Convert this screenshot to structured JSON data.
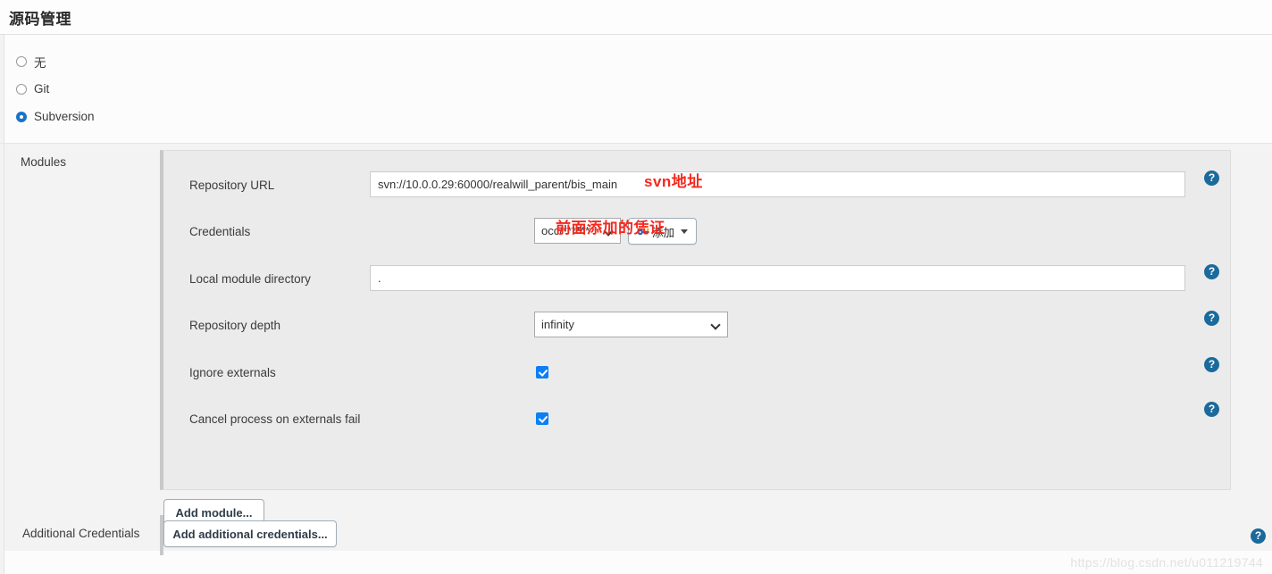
{
  "header": {
    "title": "源码管理"
  },
  "scm_options": [
    {
      "label": "无",
      "checked": false,
      "name": "none"
    },
    {
      "label": "Git",
      "checked": false,
      "name": "git"
    },
    {
      "label": "Subversion",
      "checked": true,
      "name": "subversion"
    }
  ],
  "modules": {
    "label": "Modules",
    "fields": {
      "repository_url": {
        "label": "Repository URL",
        "value": "svn://10.0.0.29:60000/realwill_parent/bis_main",
        "placeholder": ""
      },
      "credentials": {
        "label": "Credentials",
        "selected": "occ/******",
        "add_button": "添加"
      },
      "local_module_directory": {
        "label": "Local module directory",
        "value": ".",
        "placeholder": ""
      },
      "repository_depth": {
        "label": "Repository depth",
        "selected": "infinity"
      },
      "ignore_externals": {
        "label": "Ignore externals",
        "checked": true
      },
      "cancel_process_on_externals_fail": {
        "label": "Cancel process on externals fail",
        "checked": true
      }
    },
    "add_module_button": "Add module..."
  },
  "additional_credentials": {
    "label": "Additional Credentials",
    "button": "Add additional credentials..."
  },
  "annotations": [
    {
      "text": "svn地址",
      "name": "svn-url-annotation"
    },
    {
      "text": "前面添加的凭证",
      "name": "credentials-annotation"
    }
  ],
  "help_icon_glyph": "?",
  "watermark": "https://blog.csdn.net/u011219744",
  "colors": {
    "accent": "#1b6a9c",
    "checkbox": "#0b7ff5",
    "annotation": "#f4281e",
    "radio_checked": "#1a73c8"
  }
}
